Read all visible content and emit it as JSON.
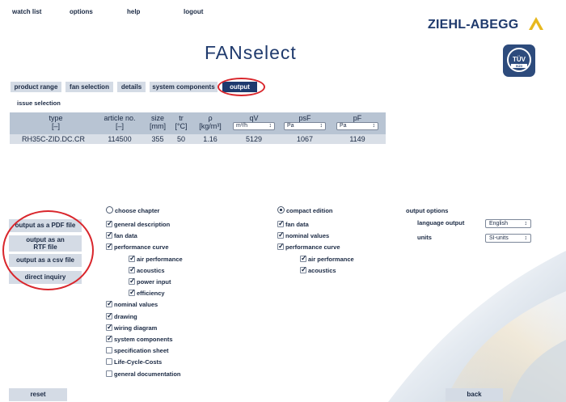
{
  "menu": [
    "watch list",
    "options",
    "help",
    "logout"
  ],
  "brand": {
    "name": "ZIEHL-ABEGG",
    "app_title": "FANselect",
    "badge_main": "TÜV",
    "badge_sub": "SÜD"
  },
  "tabs": [
    "product range",
    "fan selection",
    "details",
    "system components",
    "output"
  ],
  "active_tab": "output",
  "section_label": "issue selection",
  "table": {
    "headers": [
      {
        "name": "type",
        "unit": "[–]"
      },
      {
        "name": "article no.",
        "unit": "[–]"
      },
      {
        "name": "size",
        "unit": "[mm]"
      },
      {
        "name": "tr",
        "unit": "[°C]"
      },
      {
        "name": "ρ",
        "unit": "[kg/m³]"
      },
      {
        "name": "qV",
        "unit": "m³/h"
      },
      {
        "name": "psF",
        "unit": "Pa"
      },
      {
        "name": "pF",
        "unit": "Pa"
      }
    ],
    "row": [
      "RH35C-ZID.DC.CR",
      "114500",
      "355",
      "50",
      "1.16",
      "5129",
      "1067",
      "1149"
    ]
  },
  "actions": [
    "output as a PDF file",
    "output as an RTF file",
    "output as a csv file",
    "direct inquiry"
  ],
  "choose_chapter": {
    "label": "choose chapter",
    "selected": false,
    "items": [
      {
        "label": "general description",
        "checked": true
      },
      {
        "label": "fan data",
        "checked": true
      },
      {
        "label": "performance curve",
        "checked": true
      },
      {
        "label": "air performance",
        "checked": true
      },
      {
        "label": "acoustics",
        "checked": true
      },
      {
        "label": "power input",
        "checked": true
      },
      {
        "label": "efficiency",
        "checked": true
      },
      {
        "label": "nominal values",
        "checked": true
      },
      {
        "label": "drawing",
        "checked": true
      },
      {
        "label": "wiring diagram",
        "checked": true
      },
      {
        "label": "system components",
        "checked": true
      },
      {
        "label": "specification sheet",
        "checked": false
      },
      {
        "label": "Life-Cycle-Costs",
        "checked": false
      },
      {
        "label": "general documentation",
        "checked": false
      }
    ]
  },
  "compact_edition": {
    "label": "compact edition",
    "selected": true,
    "items": [
      {
        "label": "fan data",
        "checked": true
      },
      {
        "label": "nominal values",
        "checked": true
      },
      {
        "label": "performance curve",
        "checked": true
      },
      {
        "label": "air performance",
        "checked": true
      },
      {
        "label": "acoustics",
        "checked": true
      }
    ]
  },
  "output_options": {
    "title": "output options",
    "language_label": "language output",
    "language_value": "English",
    "units_label": "units",
    "units_value": "SI-units"
  },
  "footer": {
    "reset": "reset",
    "back": "back"
  },
  "colors": {
    "brand_blue": "#1e3a6e",
    "tab_bg": "#d4dbe5",
    "highlight_red": "#d9262c"
  }
}
